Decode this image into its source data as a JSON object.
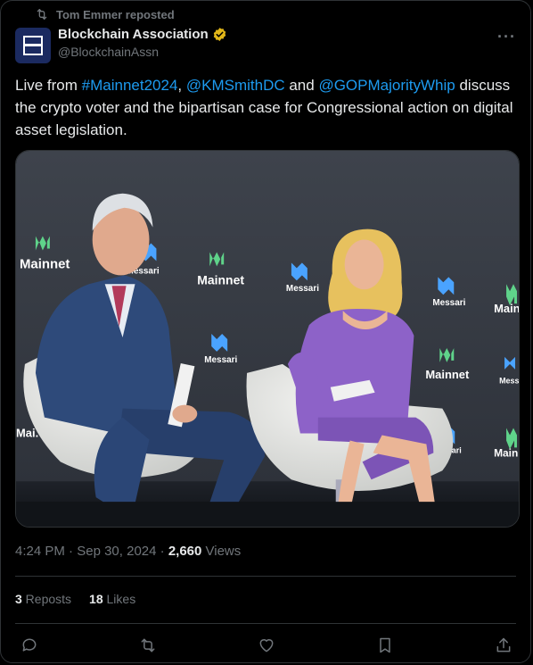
{
  "repost": {
    "text": "Tom Emmer reposted",
    "icon": "repost-icon"
  },
  "author": {
    "name": "Blockchain Association",
    "handle": "@BlockchainAssn",
    "verified_color": "#e2b719",
    "avatar_color": "#1b2a60"
  },
  "tweet": {
    "t1": "Live from ",
    "hashtag": "#Mainnet2024",
    "t2": ", ",
    "mention1": "@KMSmithDC",
    "t3": " and ",
    "mention2": "@GOPMajorityWhip",
    "t4": " discuss the crypto voter and the bipartisan case for Congressional action on digital asset legislation."
  },
  "media": {
    "backdrop_words": [
      "Mainnet",
      "Messari"
    ]
  },
  "meta": {
    "time": "4:24 PM",
    "sep1": " · ",
    "date": "Sep 30, 2024",
    "sep2": " · ",
    "views_count": "2,660",
    "views_label": " Views"
  },
  "stats": {
    "reposts_count": "3",
    "reposts_label": " Reposts",
    "likes_count": "18",
    "likes_label": " Likes"
  },
  "colors": {
    "accent": "#1d9bf0",
    "muted": "#71767b",
    "text": "#e7e9ea",
    "border": "#2f3336"
  }
}
